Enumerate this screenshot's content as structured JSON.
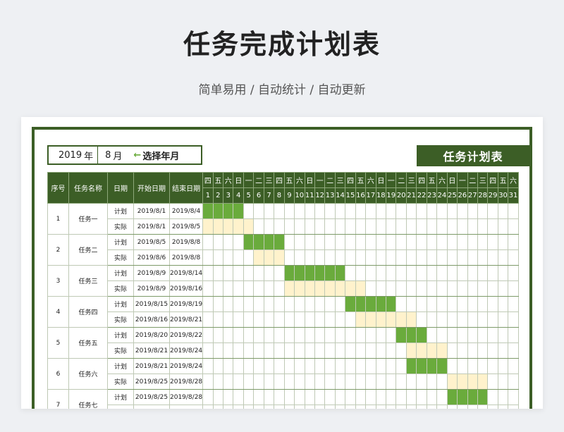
{
  "hero": {
    "title": "任务完成计划表",
    "subtitle": "简单易用 / 自动统计 / 自动更新"
  },
  "picker": {
    "year": "2019",
    "year_unit": "年",
    "month": "8",
    "month_unit": "月",
    "arrow": "←",
    "hint": "选择年月"
  },
  "sheet_title": "任务计划表",
  "headers": [
    "序号",
    "任务名称",
    "日期",
    "开始日期",
    "结束日期"
  ],
  "weekdays": [
    "四",
    "五",
    "六",
    "日",
    "一",
    "二",
    "三",
    "四",
    "五",
    "六",
    "日",
    "一",
    "二",
    "三",
    "四",
    "五",
    "六",
    "日",
    "一",
    "二",
    "三",
    "四",
    "五",
    "六",
    "日",
    "一",
    "二",
    "三",
    "四",
    "五",
    "六"
  ],
  "days": [
    "1",
    "2",
    "3",
    "4",
    "5",
    "6",
    "7",
    "8",
    "9",
    "10",
    "11",
    "12",
    "13",
    "14",
    "15",
    "16",
    "17",
    "18",
    "19",
    "20",
    "21",
    "22",
    "23",
    "24",
    "25",
    "26",
    "27",
    "28",
    "29",
    "30",
    "31"
  ],
  "row_types": {
    "plan": "计划",
    "actual": "实际"
  },
  "tasks": [
    {
      "no": "1",
      "name": "任务一",
      "plan": [
        "2019/8/1",
        "2019/8/4"
      ],
      "actual": [
        "2019/8/1",
        "2019/8/5"
      ]
    },
    {
      "no": "2",
      "name": "任务二",
      "plan": [
        "2019/8/5",
        "2019/8/8"
      ],
      "actual": [
        "2019/8/6",
        "2019/8/8"
      ]
    },
    {
      "no": "3",
      "name": "任务三",
      "plan": [
        "2019/8/9",
        "2019/8/14"
      ],
      "actual": [
        "2019/8/9",
        "2019/8/16"
      ]
    },
    {
      "no": "4",
      "name": "任务四",
      "plan": [
        "2019/8/15",
        "2019/8/19"
      ],
      "actual": [
        "2019/8/16",
        "2019/8/21"
      ]
    },
    {
      "no": "5",
      "name": "任务五",
      "plan": [
        "2019/8/20",
        "2019/8/22"
      ],
      "actual": [
        "2019/8/21",
        "2019/8/24"
      ]
    },
    {
      "no": "6",
      "name": "任务六",
      "plan": [
        "2019/8/21",
        "2019/8/24"
      ],
      "actual": [
        "2019/8/25",
        "2019/8/28"
      ]
    },
    {
      "no": "7",
      "name": "任务七",
      "plan": [
        "2019/8/25",
        "2019/8/28"
      ],
      "actual": [
        "",
        ""
      ]
    }
  ],
  "colors": {
    "frame": "#3c5e26",
    "plan_fill": "#6aab3c",
    "actual_fill": "#fff2cc",
    "arrow": "#6aab3c"
  }
}
